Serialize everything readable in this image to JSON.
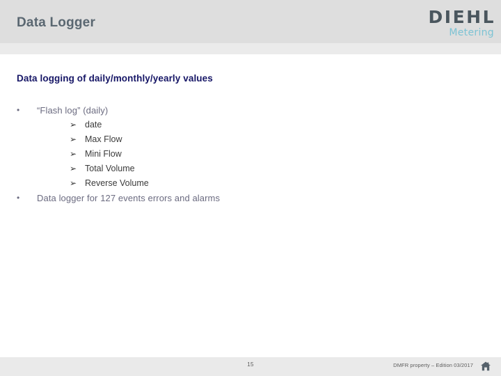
{
  "header": {
    "title": "Data Logger",
    "logo": {
      "brand": "DIEHL",
      "tagline": "Metering",
      "brand_color": "#4a565e",
      "tagline_color": "#7cc3d4"
    }
  },
  "body": {
    "heading": "Data logging of daily/monthly/yearly values",
    "bullets": [
      {
        "level": 1,
        "marker": "•",
        "text": "“Flash log” (daily)"
      },
      {
        "level": 2,
        "marker": "➢",
        "text": "date"
      },
      {
        "level": 2,
        "marker": "➢",
        "text": "Max Flow"
      },
      {
        "level": 2,
        "marker": "➢",
        "text": "Mini Flow"
      },
      {
        "level": 2,
        "marker": "➢",
        "text": "Total Volume"
      },
      {
        "level": 2,
        "marker": "➢",
        "text": "Reverse Volume"
      },
      {
        "level": 1,
        "marker": "•",
        "text": "Data logger for 127 events errors and alarms"
      }
    ]
  },
  "footer": {
    "page_number": "15",
    "copyright": "DMFR property – Edition 03/2017",
    "home_icon": "home-icon"
  },
  "colors": {
    "header_band": "#dedede",
    "header_band_light": "#ebebeb",
    "footer_band": "#eaeaea",
    "title_text": "#5a6771",
    "heading_text": "#161666",
    "bullet_l1_text": "#6b6b80",
    "bullet_l2_text": "#3b3b3b"
  }
}
